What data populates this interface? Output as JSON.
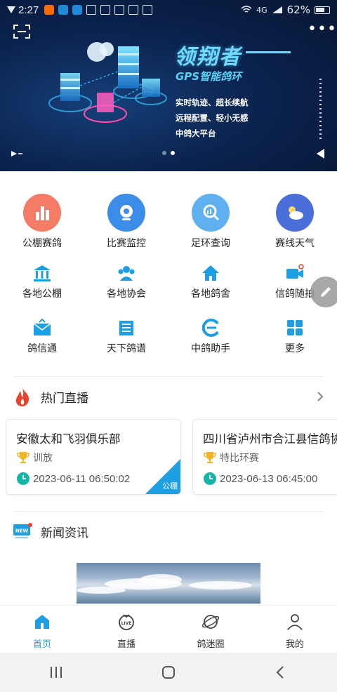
{
  "status_bar": {
    "time": "2:27",
    "network": "4G",
    "battery": "62%"
  },
  "banner": {
    "headline": "领翔者",
    "subheadline": "GPS智能鸽环",
    "features": [
      "实时轨迹、超长续航",
      "远程配置、轻小无感",
      "中鸽大平台"
    ],
    "slide_count": 2,
    "active_slide": 2
  },
  "grid": {
    "row1": [
      {
        "label": "公棚赛鸽",
        "icon": "bar-chart-icon",
        "bg": "#f47b66"
      },
      {
        "label": "比赛监控",
        "icon": "camera-icon",
        "bg": "#3b8de8"
      },
      {
        "label": "足环查询",
        "icon": "search-chart-icon",
        "bg": "#5fb0f0"
      },
      {
        "label": "赛线天气",
        "icon": "weather-icon",
        "bg": "#4a6fd8"
      }
    ],
    "row2": [
      {
        "label": "各地公棚",
        "icon": "building-icon"
      },
      {
        "label": "各地协会",
        "icon": "group-icon"
      },
      {
        "label": "各地鸽舍",
        "icon": "house-icon"
      },
      {
        "label": "信鸽随拍",
        "icon": "video-icon"
      }
    ],
    "row3": [
      {
        "label": "鸽信通",
        "icon": "mail-icon"
      },
      {
        "label": "天下鸽谱",
        "icon": "book-icon"
      },
      {
        "label": "中鸽助手",
        "icon": "logo-icon"
      },
      {
        "label": "更多",
        "icon": "more-grid-icon"
      }
    ]
  },
  "live": {
    "title": "热门直播",
    "cards": [
      {
        "title": "安徽太和飞羽俱乐部",
        "type": "训放",
        "time": "2023-06-11 06:50:02",
        "badge": "公棚"
      },
      {
        "title": "四川省泸州市合江县信鸽协",
        "type": "特比环赛",
        "time": "2023-06-13 06:45:00",
        "badge": ""
      }
    ]
  },
  "news": {
    "title": "新闻资讯",
    "badge": "NEW"
  },
  "tabs": [
    {
      "label": "首页",
      "icon": "home-icon",
      "active": true
    },
    {
      "label": "直播",
      "icon": "live-icon",
      "active": false
    },
    {
      "label": "鸽迷圈",
      "icon": "planet-icon",
      "active": false
    },
    {
      "label": "我的",
      "icon": "person-icon",
      "active": false
    }
  ],
  "colors": {
    "accent": "#1e9ee2",
    "fire": "#e8432e",
    "gold": "#f0b429",
    "teal": "#17b5a8"
  }
}
